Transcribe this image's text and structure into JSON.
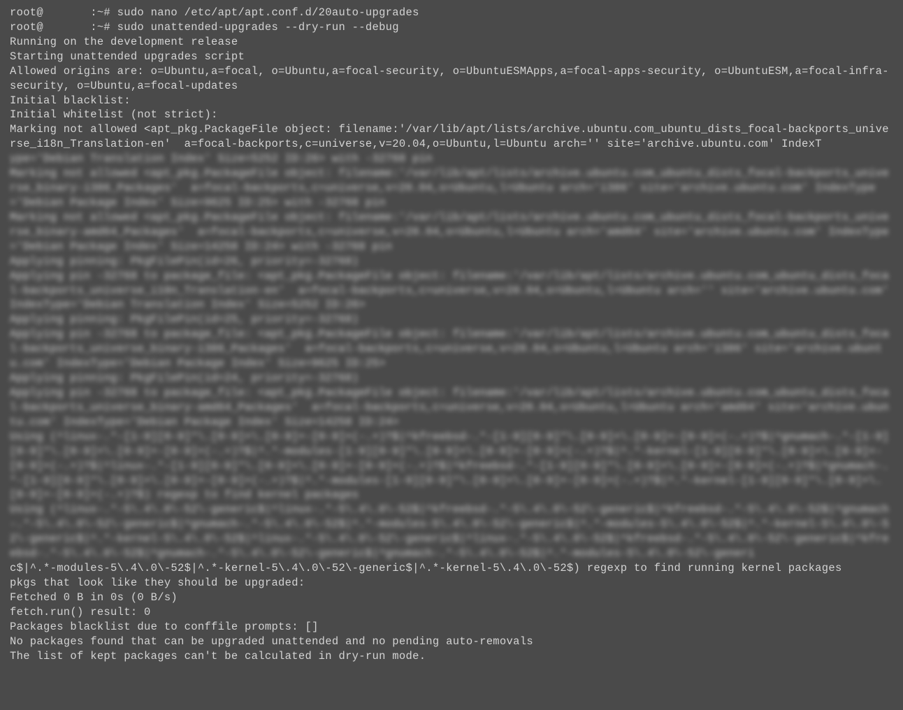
{
  "lines": {
    "prompt1": "root@       :~# sudo nano /etc/apt/apt.conf.d/20auto-upgrades",
    "prompt2": "root@       :~# sudo unattended-upgrades --dry-run --debug",
    "l1": "Running on the development release",
    "l2": "Starting unattended upgrades script",
    "l3": "Allowed origins are: o=Ubuntu,a=focal, o=Ubuntu,a=focal-security, o=UbuntuESMApps,a=focal-apps-security, o=UbuntuESM,a=focal-infra-security, o=Ubuntu,a=focal-updates",
    "l4": "Initial blacklist:",
    "l5": "Initial whitelist (not strict):",
    "l6": "Marking not allowed <apt_pkg.PackageFile object: filename:'/var/lib/apt/lists/archive.ubuntu.com_ubuntu_dists_focal-backports_universe_i18n_Translation-en'  a=focal-backports,c=universe,v=20.04,o=Ubuntu,l=Ubuntu arch='' site='archive.ubuntu.com' IndexT",
    "blur1": "ype='Debian Translation Index' Size=5252 ID:26> with -32768 pin\nMarking not allowed <apt_pkg.PackageFile object: filename:'/var/lib/apt/lists/archive.ubuntu.com_ubuntu_dists_focal-backports_universe_binary-i386_Packages'  a=focal-backports,c=universe,v=20.04,o=Ubuntu,l=Ubuntu arch='i386' site='archive.ubuntu.com' IndexType='Debian Package Index' Size=9625 ID:25> with -32768 pin\nMarking not allowed <apt_pkg.PackageFile object: filename:'/var/lib/apt/lists/archive.ubuntu.com_ubuntu_dists_focal-backports_universe_binary-amd64_Packages'  a=focal-backports,c=universe,v=20.04,o=Ubuntu,l=Ubuntu arch='amd64' site='archive.ubuntu.com' IndexType='Debian Package Index' Size=14258 ID:24> with -32768 pin\nApplying pinning: PkgFilePin(id=26, priority=-32768)\nApplying pin -32768 to package_file: <apt_pkg.PackageFile object: filename:'/var/lib/apt/lists/archive.ubuntu.com_ubuntu_dists_focal-backports_universe_i18n_Translation-en'  a=focal-backports,c=universe,v=20.04,o=Ubuntu,l=Ubuntu arch='' site='archive.ubuntu.com' IndexType='Debian Translation Index' Size=5252 ID:26>\nApplying pinning: PkgFilePin(id=25, priority=-32768)\nApplying pin -32768 to package_file: <apt_pkg.PackageFile object: filename:'/var/lib/apt/lists/archive.ubuntu.com_ubuntu_dists_focal-backports_universe_binary-i386_Packages'  a=focal-backports,c=universe,v=20.04,o=Ubuntu,l=Ubuntu arch='i386' site='archive.ubuntu.com' IndexType='Debian Package Index' Size=9625 ID:25>\nApplying pinning: PkgFilePin(id=24, priority=-32768)\nApplying pin -32768 to package_file: <apt_pkg.PackageFile object: filename:'/var/lib/apt/lists/archive.ubuntu.com_ubuntu_dists_focal-backports_universe_binary-amd64_Packages'  a=focal-backports,c=universe,v=20.04,o=Ubuntu,l=Ubuntu arch='amd64' site='archive.ubuntu.com' IndexType='Debian Package Index' Size=14258 ID:24>\nUsing (^linux-.*-[1-9][0-9]*\\.[0-9]+\\.[0-9]+-[0-9]+(-.+)?$|^kfreebsd-.*-[1-9][0-9]*\\.[0-9]+\\.[0-9]+-[0-9]+(-.+)?$|^gnumach-.*-[1-9][0-9]*\\.[0-9]+\\.[0-9]+-[0-9]+(-.+)?$|^.*-modules-[1-9][0-9]*\\.[0-9]+\\.[0-9]+-[0-9]+(-.+)?$|^.*-kernel-[1-9][0-9]*\\.[0-9]+\\.[0-9]+-[0-9]+(-.+)?$|^linux-.*-[1-9][0-9]*\\.[0-9]+\\.[0-9]+-[0-9]+(-.+)?$|^kfreebsd-.*-[1-9][0-9]*\\.[0-9]+\\.[0-9]+-[0-9]+(-.+)?$|^gnumach-.*-[1-9][0-9]*\\.[0-9]+\\.[0-9]+-[0-9]+(-.+)?$|^.*-modules-[1-9][0-9]*\\.[0-9]+\\.[0-9]+-[0-9]+(-.+)?$|^.*-kernel-[1-9][0-9]*\\.[0-9]+\\.[0-9]+-[0-9]+(-.+)?$) regexp to find kernel packages\nUsing (^linux-.*-5\\.4\\.0\\-52\\-generic$|^linux-.*-5\\.4\\.0\\-52$|^kfreebsd-.*-5\\.4\\.0\\-52\\-generic$|^kfreebsd-.*-5\\.4\\.0\\-52$|^gnumach-.*-5\\.4\\.0\\-52\\-generic$|^gnumach-.*-5\\.4\\.0\\-52$|^.*-modules-5\\.4\\.0\\-52\\-generic$|^.*-modules-5\\.4\\.0\\-52$|^.*-kernel-5\\.4\\.0\\-52\\-generic$|^.*-kernel-5\\.4\\.0\\-52$|^linux-.*-5\\.4\\.0\\-52\\-generic$|^linux-.*-5\\.4\\.0\\-52$|^kfreebsd-.*-5\\.4\\.0\\-52\\-generic$|^kfreebsd-.*-5\\.4\\.0\\-52$|^gnumach-.*-5\\.4\\.0\\-52\\-generic$|^gnumach-.*-5\\.4\\.0\\-52$|^.*-modules-5\\.4\\.0\\-52\\-generi",
    "l7": "c$|^.*-modules-5\\.4\\.0\\-52$|^.*-kernel-5\\.4\\.0\\-52\\-generic$|^.*-kernel-5\\.4\\.0\\-52$) regexp to find running kernel packages",
    "l8": "pkgs that look like they should be upgraded:",
    "l9": "Fetched 0 B in 0s (0 B/s)",
    "l10": "fetch.run() result: 0",
    "l11": "Packages blacklist due to conffile prompts: []",
    "l12": "No packages found that can be upgraded unattended and no pending auto-removals",
    "l13": "The list of kept packages can't be calculated in dry-run mode."
  }
}
